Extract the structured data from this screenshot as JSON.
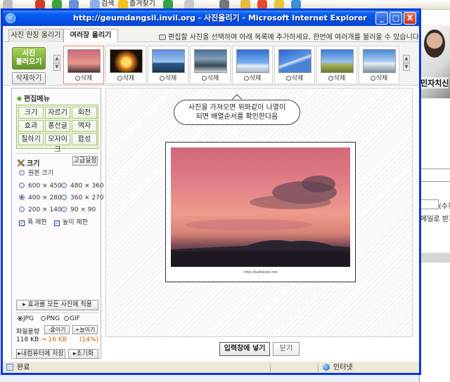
{
  "browser_toolbar": {
    "search_label": "검색",
    "favorites_label": "즐겨찾기"
  },
  "background_page": {
    "photo_caption": "민자치신",
    "label_1": "(수정",
    "label_2": "메일로 받기"
  },
  "window": {
    "title": "http://geumdangsil.invil.org - 사진올리기 - Microsoft Internet Explorer",
    "controls": {
      "minimize": "_",
      "maximize": "□",
      "close": "X"
    }
  },
  "tabs": {
    "single_upload": "사진 한장 올리기",
    "multi_upload": "여러장 올리기",
    "hint": "편집할 사진을 선택하여 아래 목록에 추가하세요. 한번에 여러개를 불러올 수 있습니다."
  },
  "strip": {
    "load_button_line1": "사진",
    "load_button_line2": "불러오기",
    "delete_button": "삭제하기",
    "thumb_delete_label": "삭제"
  },
  "panel": {
    "menu_title": "편집메뉴",
    "menu_items": [
      "크기",
      "자르기",
      "회전",
      "효과",
      "풍선글",
      "액자",
      "칠하기",
      "모자이크",
      "합성"
    ],
    "size_title": "크기",
    "advanced_button": "고급설정",
    "size_options": {
      "original": "원본 크기",
      "s600x450": "600 × 450",
      "s480x360": "480 × 360",
      "s400x280": "400 × 280",
      "s360x270": "360 × 270",
      "s200x140": "200 × 140",
      "s90x90": "90 × 90"
    },
    "selected_size": "400 × 280",
    "width_limit": "폭 제한",
    "height_limit": "높이 제한",
    "apply_all_button": "효과를 모든 사진에 적용",
    "formats": {
      "jpg": "JPG",
      "png": "PNG",
      "gif": "GIF"
    },
    "selected_format": "JPG",
    "file_size_label": "파일용량",
    "decrease_button": "-줄이기",
    "increase_button": "+늘이기",
    "original_size": "118 KB",
    "arrow": "→",
    "new_size": "16 KB",
    "ratio": "(14%)",
    "save_to_pc_button": "내컴퓨터에 저장",
    "reset_button": "초기화"
  },
  "canvas": {
    "bubble_line1": "사진을 가져오면 위와같이 나열이",
    "bubble_line2": "되면 배열순서를 확인한다음",
    "photo_credit": "http://bulkwosil.net"
  },
  "actions": {
    "insert_button": "입력창에 넣기",
    "close_button": "닫기"
  },
  "status": {
    "text": "완료",
    "zone": "인터넷"
  }
}
